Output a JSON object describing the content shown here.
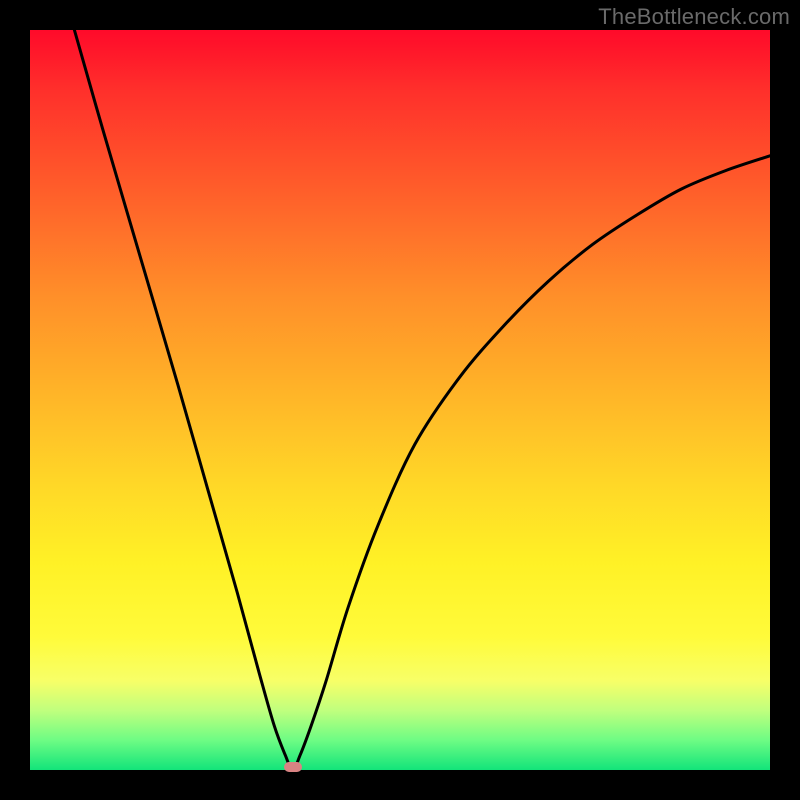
{
  "watermark": "TheBottleneck.com",
  "colors": {
    "frame": "#000000",
    "gradient_top": "#ff0a2a",
    "gradient_mid": "#ffd927",
    "gradient_bottom": "#12e47a",
    "curve": "#000000",
    "marker": "#d98383"
  },
  "chart_data": {
    "type": "line",
    "title": "",
    "xlabel": "",
    "ylabel": "",
    "xlim": [
      0,
      100
    ],
    "ylim": [
      0,
      100
    ],
    "legend": false,
    "grid": false,
    "series": [
      {
        "name": "bottleneck-curve",
        "x": [
          6,
          10,
          15,
          20,
          24,
          28,
          31,
          33,
          34.5,
          35.5,
          36.5,
          38,
          40,
          43,
          47,
          52,
          58,
          64,
          70,
          76,
          82,
          88,
          94,
          100
        ],
        "y": [
          100,
          86,
          69,
          52,
          38,
          24,
          13,
          6,
          2,
          0,
          2,
          6,
          12,
          22,
          33,
          44,
          53,
          60,
          66,
          71,
          75,
          78.5,
          81,
          83
        ]
      }
    ],
    "annotations": [
      {
        "name": "minimum-point",
        "x": 35.5,
        "y": 0
      }
    ]
  }
}
